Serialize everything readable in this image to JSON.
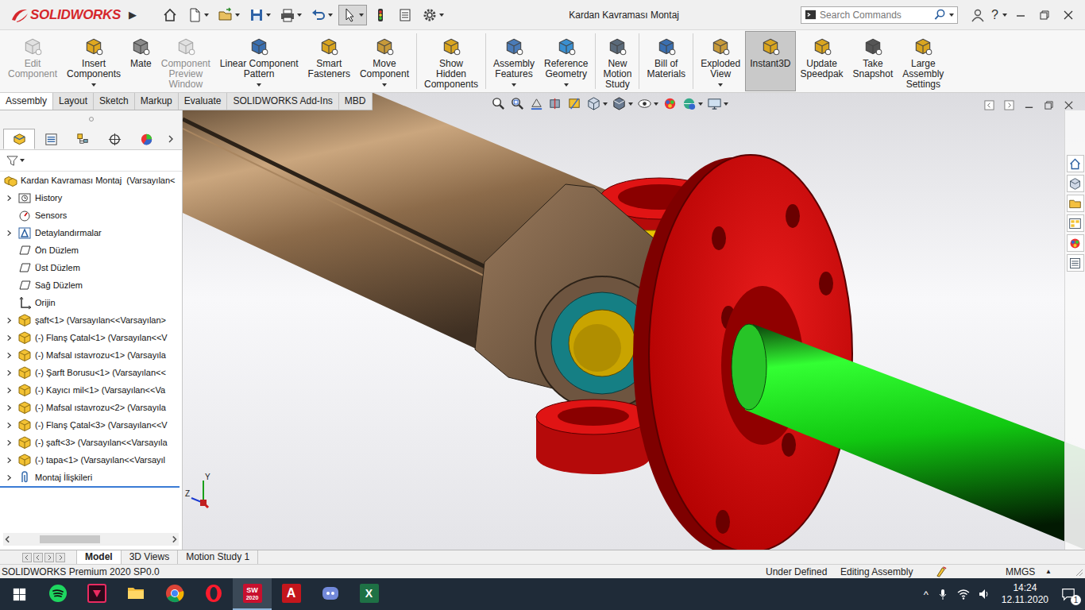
{
  "window": {
    "title": "Kardan Kavraması Montaj",
    "logo": "SOLIDWORKS",
    "expand_arrow": "▶",
    "help": "?"
  },
  "quick_access": [
    {
      "kind": "home",
      "dropdown": false,
      "selected": false
    },
    {
      "kind": "new",
      "dropdown": true,
      "selected": false
    },
    {
      "kind": "open",
      "dropdown": true,
      "selected": false
    },
    {
      "kind": "save",
      "dropdown": true,
      "selected": false
    },
    {
      "kind": "print",
      "dropdown": true,
      "selected": false
    },
    {
      "kind": "undo",
      "dropdown": true,
      "selected": false
    },
    {
      "kind": "select",
      "dropdown": true,
      "selected": true
    },
    {
      "kind": "rebuild",
      "dropdown": false,
      "selected": false
    },
    {
      "kind": "properties",
      "dropdown": false,
      "selected": false
    },
    {
      "kind": "options",
      "dropdown": true,
      "selected": false
    }
  ],
  "search": {
    "placeholder": "Search Commands"
  },
  "ribbon": [
    {
      "buttons": [
        {
          "kind": "edit-component",
          "lines": [
            "Edit",
            "Component"
          ],
          "disabled": true,
          "selected": false,
          "dropdown": false
        },
        {
          "kind": "insert-components",
          "lines": [
            "Insert",
            "Components"
          ],
          "disabled": false,
          "selected": false,
          "dropdown": true
        },
        {
          "kind": "mate",
          "lines": [
            "Mate"
          ],
          "disabled": false,
          "selected": false,
          "dropdown": false
        },
        {
          "kind": "component-preview",
          "lines": [
            "Component",
            "Preview",
            "Window"
          ],
          "disabled": true,
          "selected": false,
          "dropdown": false
        },
        {
          "kind": "linear-pattern",
          "lines": [
            "Linear Component",
            "Pattern"
          ],
          "disabled": false,
          "selected": false,
          "dropdown": true
        },
        {
          "kind": "smart-fasteners",
          "lines": [
            "Smart",
            "Fasteners"
          ],
          "disabled": false,
          "selected": false,
          "dropdown": false
        },
        {
          "kind": "move-component",
          "lines": [
            "Move",
            "Component"
          ],
          "disabled": false,
          "selected": false,
          "dropdown": true
        }
      ]
    },
    {
      "buttons": [
        {
          "kind": "show-hidden",
          "lines": [
            "Show",
            "Hidden",
            "Components"
          ],
          "disabled": false,
          "selected": false,
          "dropdown": false
        }
      ]
    },
    {
      "buttons": [
        {
          "kind": "assembly-features",
          "lines": [
            "Assembly",
            "Features"
          ],
          "disabled": false,
          "selected": false,
          "dropdown": true
        },
        {
          "kind": "reference-geometry",
          "lines": [
            "Reference",
            "Geometry"
          ],
          "disabled": false,
          "selected": false,
          "dropdown": true
        }
      ]
    },
    {
      "buttons": [
        {
          "kind": "motion-study",
          "lines": [
            "New",
            "Motion",
            "Study"
          ],
          "disabled": false,
          "selected": false,
          "dropdown": false
        }
      ]
    },
    {
      "buttons": [
        {
          "kind": "bill-of-materials",
          "lines": [
            "Bill of",
            "Materials"
          ],
          "disabled": false,
          "selected": false,
          "dropdown": false
        }
      ]
    },
    {
      "buttons": [
        {
          "kind": "exploded-view",
          "lines": [
            "Exploded",
            "View"
          ],
          "disabled": false,
          "selected": false,
          "dropdown": true
        },
        {
          "kind": "instant3d",
          "lines": [
            "Instant3D"
          ],
          "disabled": false,
          "selected": true,
          "dropdown": false
        },
        {
          "kind": "update-speedpak",
          "lines": [
            "Update",
            "Speedpak"
          ],
          "disabled": false,
          "selected": false,
          "dropdown": false
        },
        {
          "kind": "take-snapshot",
          "lines": [
            "Take",
            "Snapshot"
          ],
          "disabled": false,
          "selected": false,
          "dropdown": false
        },
        {
          "kind": "large-assembly",
          "lines": [
            "Large",
            "Assembly",
            "Settings"
          ],
          "disabled": false,
          "selected": false,
          "dropdown": false
        }
      ]
    }
  ],
  "command_tabs": [
    {
      "label": "Assembly",
      "selected": true
    },
    {
      "label": "Layout",
      "selected": false
    },
    {
      "label": "Sketch",
      "selected": false
    },
    {
      "label": "Markup",
      "selected": false
    },
    {
      "label": "Evaluate",
      "selected": false
    },
    {
      "label": "SOLIDWORKS Add-Ins",
      "selected": false
    },
    {
      "label": "MBD",
      "selected": false
    }
  ],
  "feature_manager": {
    "tabs": [
      {
        "kind": "feature-tree",
        "selected": true
      },
      {
        "kind": "property-manager",
        "selected": false
      },
      {
        "kind": "configuration-manager",
        "selected": false
      },
      {
        "kind": "dimxpert",
        "selected": false
      },
      {
        "kind": "display-manager",
        "selected": false
      }
    ],
    "root": "Kardan Kavraması Montaj  (Varsayılan<",
    "items": [
      {
        "label": "History",
        "kind": "history",
        "expandable": true
      },
      {
        "label": "Sensors",
        "kind": "sensor",
        "expandable": false
      },
      {
        "label": "Detaylandırmalar",
        "kind": "annotation",
        "expandable": true
      },
      {
        "label": "Ön Düzlem",
        "kind": "plane",
        "expandable": false
      },
      {
        "label": "Üst Düzlem",
        "kind": "plane",
        "expandable": false
      },
      {
        "label": "Sağ Düzlem",
        "kind": "plane",
        "expandable": false
      },
      {
        "label": "Orijin",
        "kind": "origin",
        "expandable": false
      },
      {
        "label": "şaft<1> (Varsayılan<<Varsayılan>",
        "kind": "part",
        "expandable": true
      },
      {
        "label": "(-) Flanş Çatal<1> (Varsayılan<<V",
        "kind": "part",
        "expandable": true
      },
      {
        "label": "(-) Mafsal ıstavrozu<1> (Varsayıla",
        "kind": "part",
        "expandable": true
      },
      {
        "label": "(-) Şarft Borusu<1> (Varsayılan<<",
        "kind": "part",
        "expandable": true
      },
      {
        "label": "(-) Kayıcı mil<1> (Varsayılan<<Va",
        "kind": "part",
        "expandable": true
      },
      {
        "label": "(-) Mafsal ıstavrozu<2> (Varsayıla",
        "kind": "part",
        "expandable": true
      },
      {
        "label": "(-) Flanş Çatal<3> (Varsayılan<<V",
        "kind": "part",
        "expandable": true
      },
      {
        "label": "(-) şaft<3> (Varsayılan<<Varsayıla",
        "kind": "part",
        "expandable": true
      },
      {
        "label": "(-) tapa<1> (Varsayılan<<Varsayıl",
        "kind": "part",
        "expandable": true
      },
      {
        "label": "Montaj İlişkileri",
        "kind": "mates",
        "expandable": true
      }
    ]
  },
  "model_tabs": [
    {
      "label": "Model",
      "selected": true
    },
    {
      "label": "3D Views",
      "selected": false
    },
    {
      "label": "Motion Study 1",
      "selected": false
    }
  ],
  "status_bar": {
    "product": "SOLIDWORKS Premium 2020 SP0.0",
    "state": "Under Defined",
    "mode": "Editing Assembly",
    "units": "MMGS",
    "units_arrow": "▲"
  },
  "triad": {
    "y": "Y",
    "z": "Z"
  },
  "taskbar": {
    "apps": [
      {
        "kind": "spotify",
        "active": false,
        "texts": []
      },
      {
        "kind": "media-encoder",
        "active": false,
        "texts": []
      },
      {
        "kind": "file-explorer",
        "active": false,
        "texts": []
      },
      {
        "kind": "chrome",
        "active": false,
        "texts": []
      },
      {
        "kind": "opera",
        "active": false,
        "texts": []
      },
      {
        "kind": "solidworks",
        "active": true,
        "texts": [
          "SW",
          "2020"
        ]
      },
      {
        "kind": "autocad",
        "active": false,
        "texts": [
          "A"
        ]
      },
      {
        "kind": "discord",
        "active": false,
        "texts": []
      },
      {
        "kind": "excel",
        "active": false,
        "texts": [
          "X"
        ]
      }
    ],
    "tray": {
      "arrow": "^",
      "time": "14:24",
      "date": "12.11.2020",
      "notifications": "1"
    }
  }
}
